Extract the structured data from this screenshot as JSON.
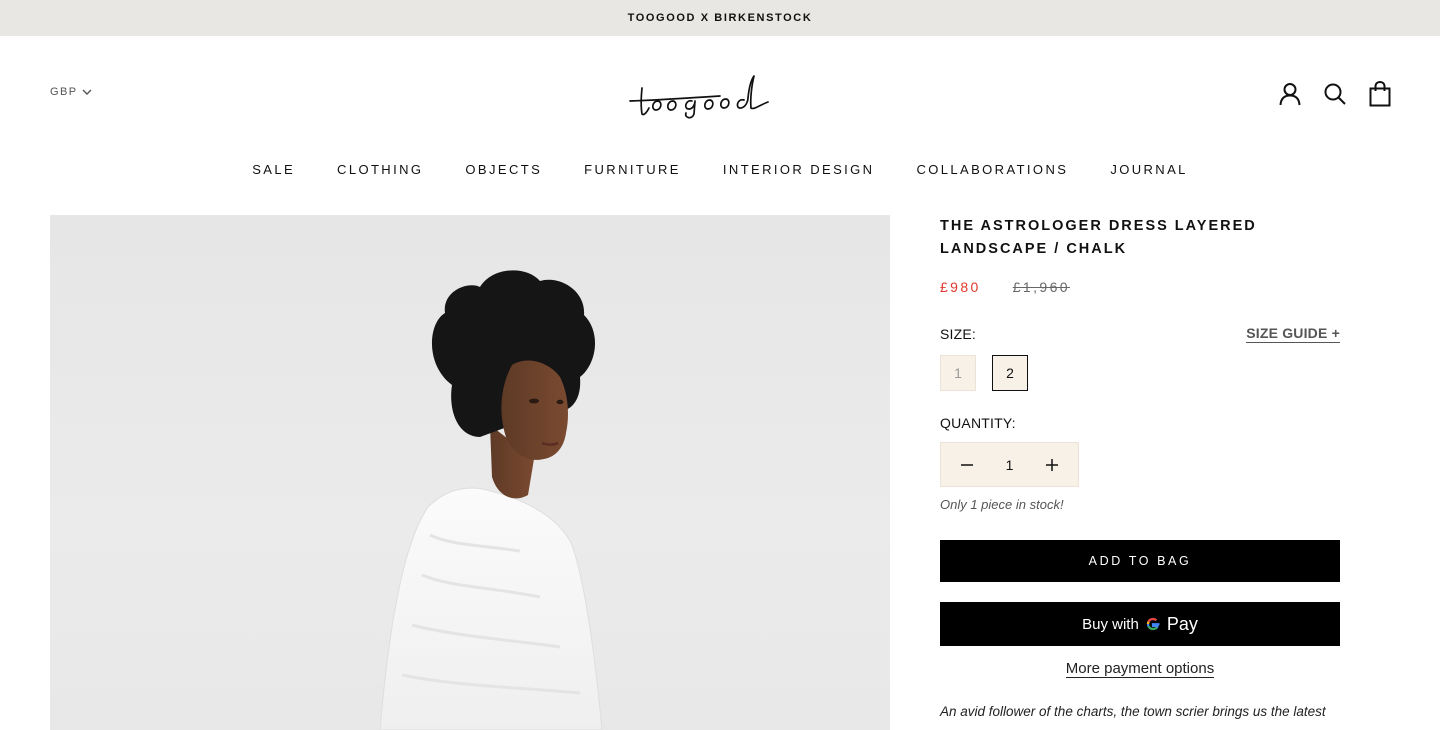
{
  "announcement": "TOOGOOD X BIRKENSTOCK",
  "header": {
    "currency": "GBP",
    "logo_text": "toogood",
    "icons": [
      "account-icon",
      "search-icon",
      "bag-icon"
    ]
  },
  "nav": {
    "items": [
      "SALE",
      "CLOTHING",
      "OBJECTS",
      "FURNITURE",
      "INTERIOR DESIGN",
      "COLLABORATIONS",
      "JOURNAL"
    ]
  },
  "product": {
    "title_line1": "THE ASTROLOGER DRESS LAYERED",
    "title_line2": "LANDSCAPE / CHALK",
    "price_sale": "£980",
    "price_compare": "£1,960",
    "size_label": "SIZE:",
    "size_guide": "SIZE GUIDE +",
    "sizes": [
      {
        "label": "1",
        "state": "unavailable"
      },
      {
        "label": "2",
        "state": "selected"
      }
    ],
    "quantity_label": "QUANTITY:",
    "quantity": "1",
    "stock_note": "Only 1 piece in stock!",
    "add_to_bag": "ADD TO BAG",
    "gpay_prefix": "Buy with",
    "gpay_suffix": "Pay",
    "more_payment": "More payment options",
    "description_start": "An avid follower of the charts, the town scrier brings us the latest"
  },
  "colors": {
    "announcement_bg": "#e8e7e3",
    "sale_price": "#e0382c",
    "swatch_bg": "#f8f1e8",
    "button_bg": "#000000"
  }
}
